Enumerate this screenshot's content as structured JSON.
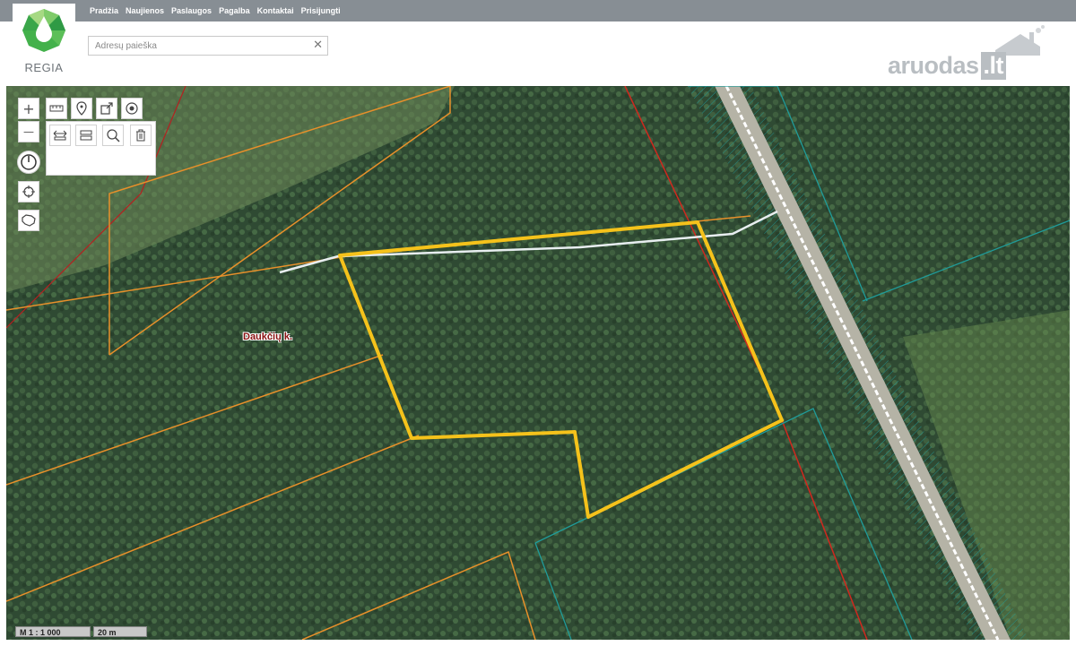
{
  "nav": {
    "items": [
      "Pradžia",
      "Naujienos",
      "Paslaugos",
      "Pagalba",
      "Kontaktai",
      "Prisijungti"
    ]
  },
  "logo": {
    "text": "REGIA"
  },
  "search": {
    "placeholder": "Adresų paieška",
    "value": "",
    "clear_glyph": "✕"
  },
  "brand": {
    "name": "aruodas",
    "tld": ".lt"
  },
  "map": {
    "place_label": "Daukčių k.",
    "scale": "M 1 : 1 000",
    "scale_length": "20 m",
    "colors": {
      "selected_parcel": "#f5c21b",
      "parcel_lines": "#e8902a",
      "boundary_red": "#d0281e",
      "boundary_teal": "#1f9c9a",
      "road_line": "#e8eef0"
    }
  },
  "tools": {
    "zoom_in": "+",
    "zoom_out": "—"
  }
}
